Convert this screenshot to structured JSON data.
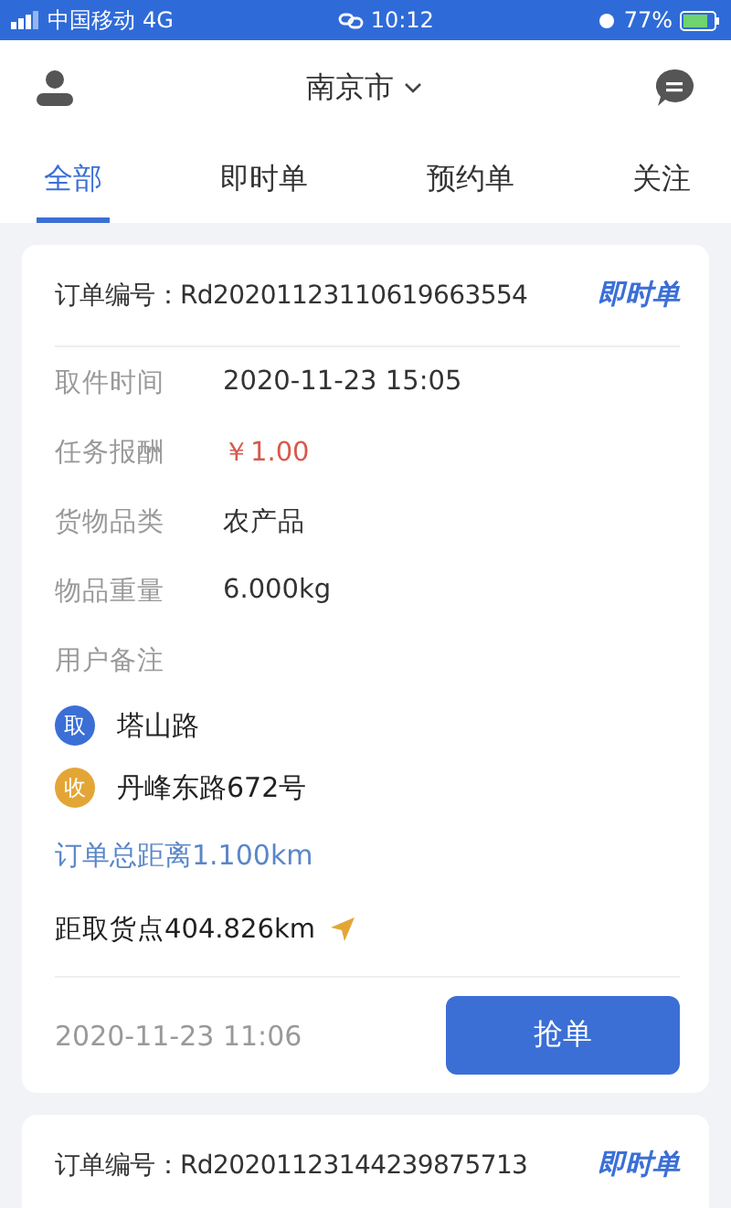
{
  "status_bar": {
    "carrier": "中国移动",
    "network": "4G",
    "time": "10:12",
    "battery": "77%"
  },
  "header": {
    "city": "南京市"
  },
  "tabs": [
    {
      "label": "全部",
      "selected": true
    },
    {
      "label": "即时单",
      "selected": false
    },
    {
      "label": "预约单",
      "selected": false
    },
    {
      "label": "关注",
      "selected": false
    }
  ],
  "orders": [
    {
      "order_label": "订单编号：",
      "order_no": "Rd20201123110619663554",
      "type": "即时单",
      "details": [
        {
          "label": "取件时间",
          "value": "2020-11-23 15:05",
          "kind": "text"
        },
        {
          "label": "任务报酬",
          "value": "￥1.00",
          "kind": "money"
        },
        {
          "label": "货物品类",
          "value": "农产品",
          "kind": "text"
        },
        {
          "label": "物品重量",
          "value": "6.000kg",
          "kind": "text"
        },
        {
          "label": "用户备注"
        }
      ],
      "addresses": [
        {
          "badge": "取",
          "address": "塔山路",
          "color": "#3b6fd6"
        },
        {
          "badge": "收",
          "address": "丹峰东路672号",
          "color": "#e3a636"
        }
      ],
      "total_distance": "订单总距离1.100km",
      "pickup_distance": "距取货点404.826km",
      "created": "2020-11-23 11:06",
      "action": "抢单"
    },
    {
      "order_label": "订单编号：",
      "order_no": "Rd20201123144239875713",
      "type": "即时单"
    }
  ]
}
